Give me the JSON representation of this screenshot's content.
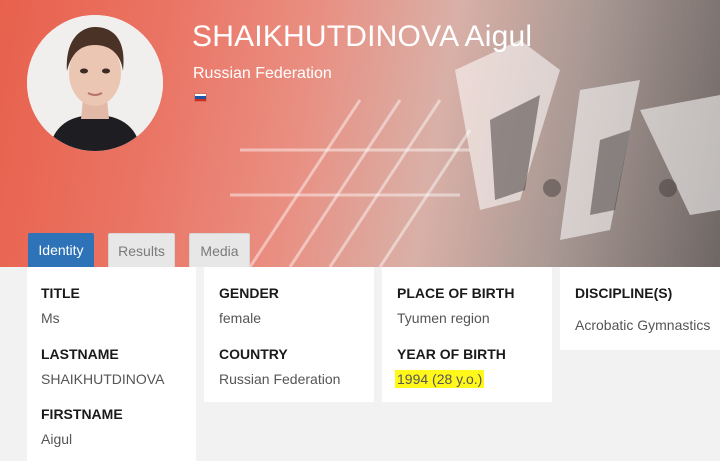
{
  "athlete": {
    "name": "SHAIKHUTDINOVA Aigul",
    "country": "Russian Federation",
    "flag": "russia-flag-icon"
  },
  "tabs": [
    {
      "label": "Identity",
      "active": true
    },
    {
      "label": "Results",
      "active": false
    },
    {
      "label": "Media",
      "active": false
    }
  ],
  "fields": {
    "title": {
      "label": "TITLE",
      "value": "Ms"
    },
    "lastname": {
      "label": "LASTNAME",
      "value": "SHAIKHUTDINOVA"
    },
    "firstname": {
      "label": "FIRSTNAME",
      "value": "Aigul"
    },
    "gender": {
      "label": "GENDER",
      "value": "female"
    },
    "country": {
      "label": "COUNTRY",
      "value": "Russian Federation"
    },
    "place_of_birth": {
      "label": "PLACE OF BIRTH",
      "value": "Tyumen region"
    },
    "year_of_birth": {
      "label": "YEAR OF BIRTH",
      "value": "1994 (28 y.o.)"
    },
    "disciplines": {
      "label": "DISCIPLINE(S)",
      "value": "Acrobatic Gymnastics"
    }
  },
  "colors": {
    "accent": "#2e73b8",
    "highlight": "#fff81a",
    "tab_inactive": "#e7e7e7"
  }
}
